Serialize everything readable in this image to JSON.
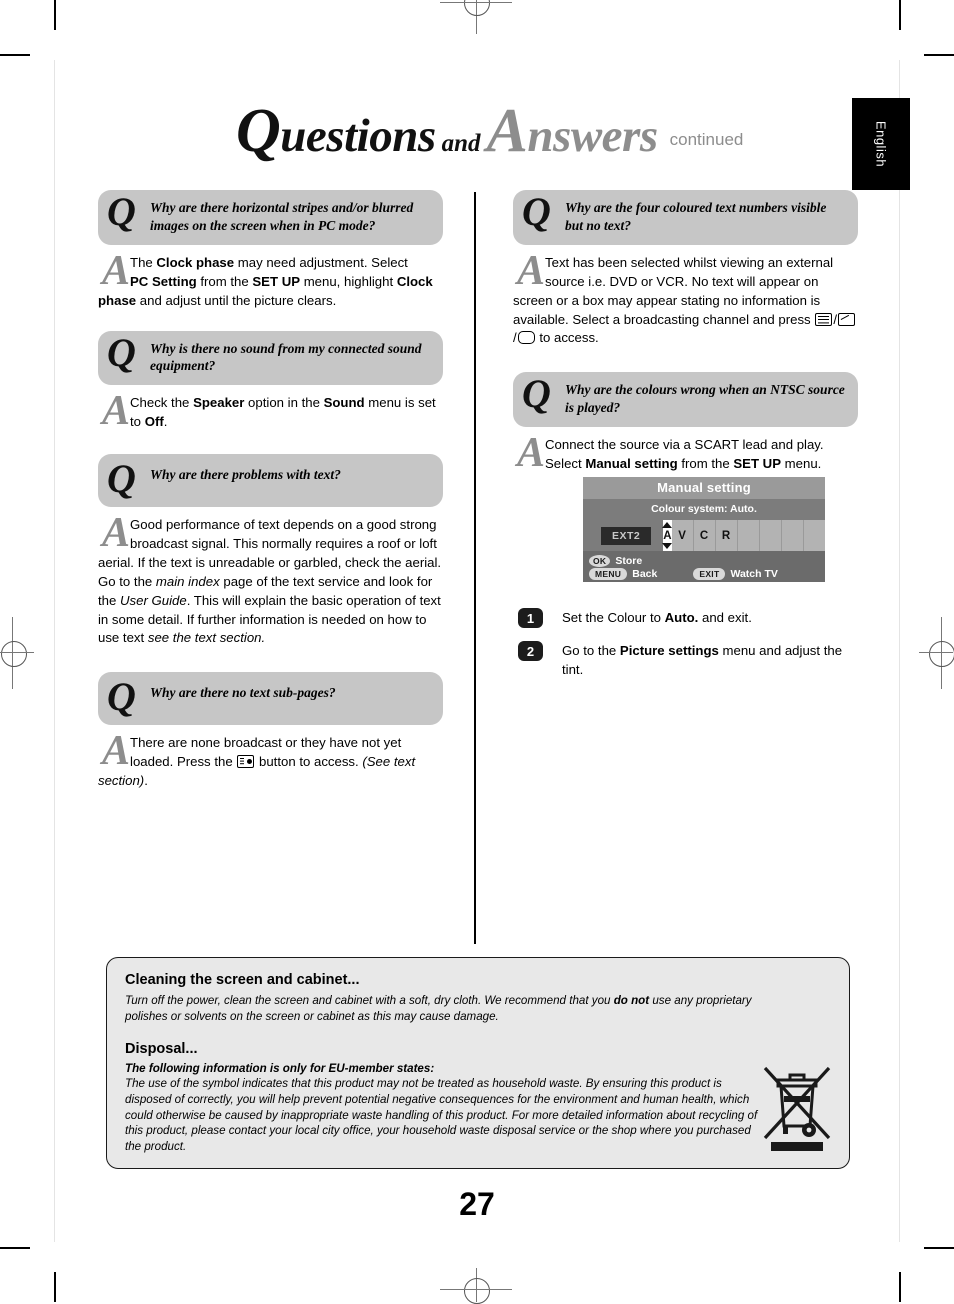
{
  "header": {
    "title_q": "Questions",
    "title_and": "and",
    "title_a": "Answers",
    "continued": "continued"
  },
  "language_tab": {
    "label": "English"
  },
  "left_column": {
    "qa": [
      {
        "q_mark": "Q",
        "question": "Why are there horizontal stripes and/or blurred images on the screen when in PC mode?",
        "a_mark": "A",
        "answer": "The Clock phase may need adjustment. Select PC Setting from the SET UP menu, highlight Clock phase and adjust until the picture clears."
      },
      {
        "q_mark": "Q",
        "question": "Why is there no sound from my connected sound equipment?",
        "a_mark": "A",
        "answer": "Check the Speaker option in the Sound menu is set to Off."
      },
      {
        "q_mark": "Q",
        "question": "Why are there problems with text?",
        "a_mark": "A",
        "answer": "Good performance of text depends on a good strong broadcast signal. This normally requires a roof or loft aerial. If the text is unreadable or garbled, check the aerial. Go to the main index page of the text service and look for the User Guide. This will explain the basic operation of text in some detail. If further information is needed on how to use text see the text section."
      },
      {
        "q_mark": "Q",
        "question": "Why are there no text sub-pages?",
        "a_mark": "A",
        "answer": "There are none broadcast or they have not yet loaded. Press the button to access. (See text section)."
      }
    ]
  },
  "right_column": {
    "qa": [
      {
        "q_mark": "Q",
        "question": "Why are the four coloured text numbers visible but no text?",
        "a_mark": "A",
        "answer": "Text has been selected whilst viewing an external source i.e. DVD or VCR. No text will appear on screen or a box may appear stating no information is available. Select a broadcasting channel and press / / to access."
      },
      {
        "q_mark": "Q",
        "question": "Why are the colours wrong when an NTSC source is played?",
        "a_mark": "A",
        "answer": "Connect the source via a SCART lead and play. Select Manual setting from the SET UP menu."
      }
    ]
  },
  "osd": {
    "title": "Manual setting",
    "subtitle": "Colour system: Auto.",
    "source_label": "EXT2",
    "selected_char": "A",
    "name_cells": [
      "V",
      "C",
      "R",
      "",
      "",
      "",
      "",
      ""
    ],
    "footer": [
      {
        "key": "OK",
        "label": "Store"
      },
      {
        "key": "MENU",
        "label": "Back"
      },
      {
        "key": "EXIT",
        "label": "Watch TV"
      }
    ]
  },
  "steps": [
    {
      "num": "1",
      "text": "Set the Colour to Auto. and exit."
    },
    {
      "num": "2",
      "text": "Go to the Picture settings menu and adjust the tint."
    }
  ],
  "info_box": {
    "cleaning_heading": "Cleaning the screen and cabinet...",
    "cleaning_body_1": "Turn off the power, clean the screen and cabinet with a soft, dry cloth. We recommend that you ",
    "cleaning_body_bold": "do not",
    "cleaning_body_2": " use any proprietary polishes or solvents on the screen or cabinet as this may cause damage.",
    "disposal_heading": "Disposal...",
    "disposal_lead": "The following information is only for EU-member states:",
    "disposal_body": "The use of the symbol indicates that this product may not be treated as household waste. By ensuring this product is disposed of correctly, you will help prevent potential negative consequences for the environment and human health, which could otherwise be caused by inappropriate waste handling of this product. For more detailed information about recycling of this product, please contact your local city office, your household waste disposal service or the shop where you purchased the product."
  },
  "page_number": "27",
  "colors": {
    "q_box_grey": "#c6c6c6",
    "a_mark_grey": "#8d8d8d",
    "info_box_grey": "#e8e8e8",
    "osd_body": "#7c7c7c",
    "osd_title_bar": "#9a9a9a",
    "osd_footer": "#6b6b6b"
  }
}
